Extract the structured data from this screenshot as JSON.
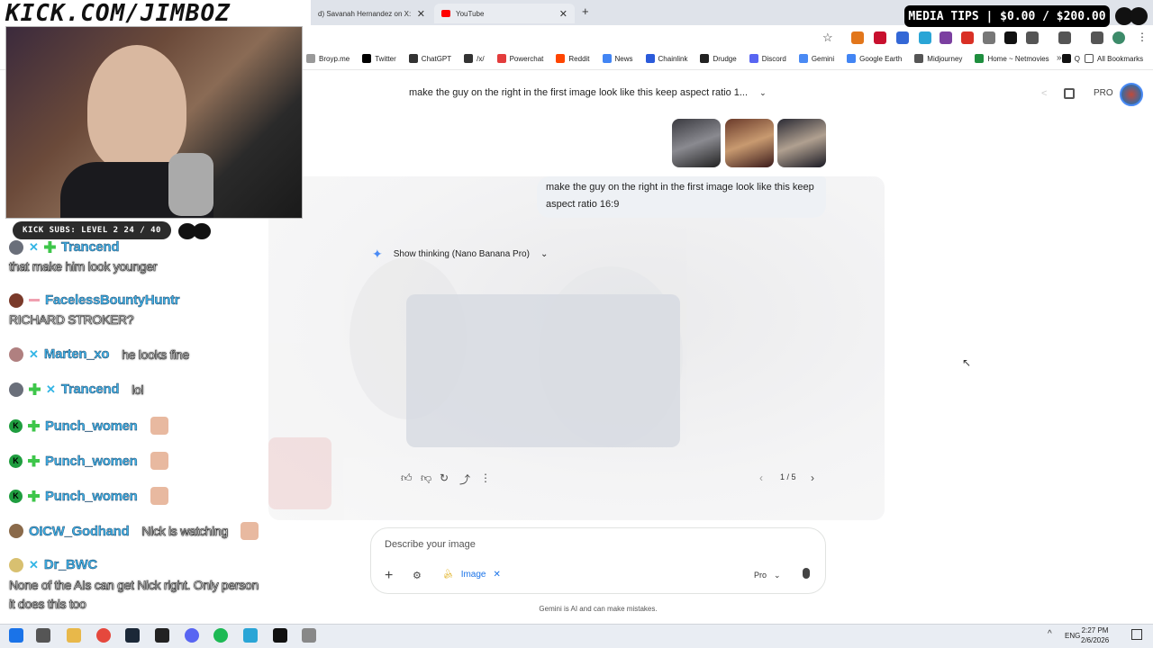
{
  "browser": {
    "tabs": [
      {
        "label": "d) Savanah Hernandez on X:",
        "color": "#222222"
      },
      {
        "label": "YouTube",
        "color": "#ff0000"
      }
    ],
    "new_tab": "+",
    "bookmarks": [
      {
        "label": "Broyp.me",
        "color": "#999999"
      },
      {
        "label": "Twitter",
        "color": "#000000"
      },
      {
        "label": "ChatGPT",
        "color": "#333333"
      },
      {
        "label": "/x/",
        "color": "#333333"
      },
      {
        "label": "Powerchat",
        "color": "#e33c3c"
      },
      {
        "label": "Reddit",
        "color": "#ff4500"
      },
      {
        "label": "News",
        "color": "#4285f4"
      },
      {
        "label": "Chainlink",
        "color": "#2a5ada"
      },
      {
        "label": "Drudge",
        "color": "#222222"
      },
      {
        "label": "Discord",
        "color": "#5865f2"
      },
      {
        "label": "Gemini",
        "color": "#4a8af4"
      },
      {
        "label": "Google Earth",
        "color": "#4285f4"
      },
      {
        "label": "Midjourney",
        "color": "#555555"
      },
      {
        "label": "Home ~ Netmovies",
        "color": "#1e8e3e"
      },
      {
        "label": "Q",
        "color": "#111111"
      }
    ],
    "all_bookmarks": "All Bookmarks"
  },
  "overlay": {
    "channel": "KICK.COM/JIMBOZ",
    "subs": "KICK SUBS: LEVEL 2 24 / 40",
    "media_tips": "MEDIA TIPS | $0.00 / $200.00"
  },
  "chat": [
    {
      "name": "Trancend",
      "message": "",
      "badges": [
        "sword",
        "gem"
      ],
      "avatar": "#6a6f7a"
    },
    {
      "name": "",
      "message": "that make him look younger",
      "badges": [],
      "avatar": ""
    },
    {
      "name": "FacelessBountyHuntr",
      "message": "",
      "badges": [
        "dash"
      ],
      "avatar": "#7a3a2a"
    },
    {
      "name": "",
      "message": "RICHARD STROKER?",
      "badges": [],
      "avatar": ""
    },
    {
      "name": "Marten_xo",
      "message": "he looks fine",
      "badges": [
        "sword"
      ],
      "avatar": "#b08080"
    },
    {
      "name": "Trancend",
      "message": "lol",
      "badges": [
        "gem",
        "sword"
      ],
      "avatar": "#6a6f7a"
    },
    {
      "name": "Punch_women",
      "message": "",
      "badges": [
        "k",
        "gem"
      ],
      "avatar": "",
      "emote": true
    },
    {
      "name": "Punch_women",
      "message": "",
      "badges": [
        "k",
        "gem"
      ],
      "avatar": "",
      "emote": true
    },
    {
      "name": "Punch_women",
      "message": "",
      "badges": [
        "k",
        "gem"
      ],
      "avatar": "",
      "emote": true
    },
    {
      "name": "OICW_Godhand",
      "message": "Nick is watching",
      "badges": [],
      "avatar": "#8a6a4a",
      "emote": true
    },
    {
      "name": "Dr_BWC",
      "message": "",
      "badges": [
        "sword"
      ],
      "avatar": "#d8c070"
    },
    {
      "name": "",
      "message": "None of the AIs can get Nick right. Only person",
      "badges": [],
      "avatar": ""
    },
    {
      "name": "",
      "message": "it does this too",
      "badges": [],
      "avatar": ""
    }
  ],
  "gemini": {
    "conversation_title": "make the guy on the right in the first image look like this keep aspect ratio 1...",
    "pro_label": "PRO",
    "user_message": "make the guy on the right in the first image look like this keep aspect ratio 16:9",
    "thinking_label": "Show thinking (Nano Banana Pro)",
    "pagination": "1 / 5",
    "input_placeholder": "Describe your image",
    "image_chip": "Image",
    "model_select": "Pro",
    "disclaimer": "Gemini is AI and can make mistakes."
  },
  "taskbar": {
    "language": "ENG",
    "time": "2:27 PM",
    "date": "2/6/2026"
  },
  "colors": {
    "accent": "#1a73e8",
    "chat_name": "#3fb0e6",
    "media_bg": "#000000"
  }
}
